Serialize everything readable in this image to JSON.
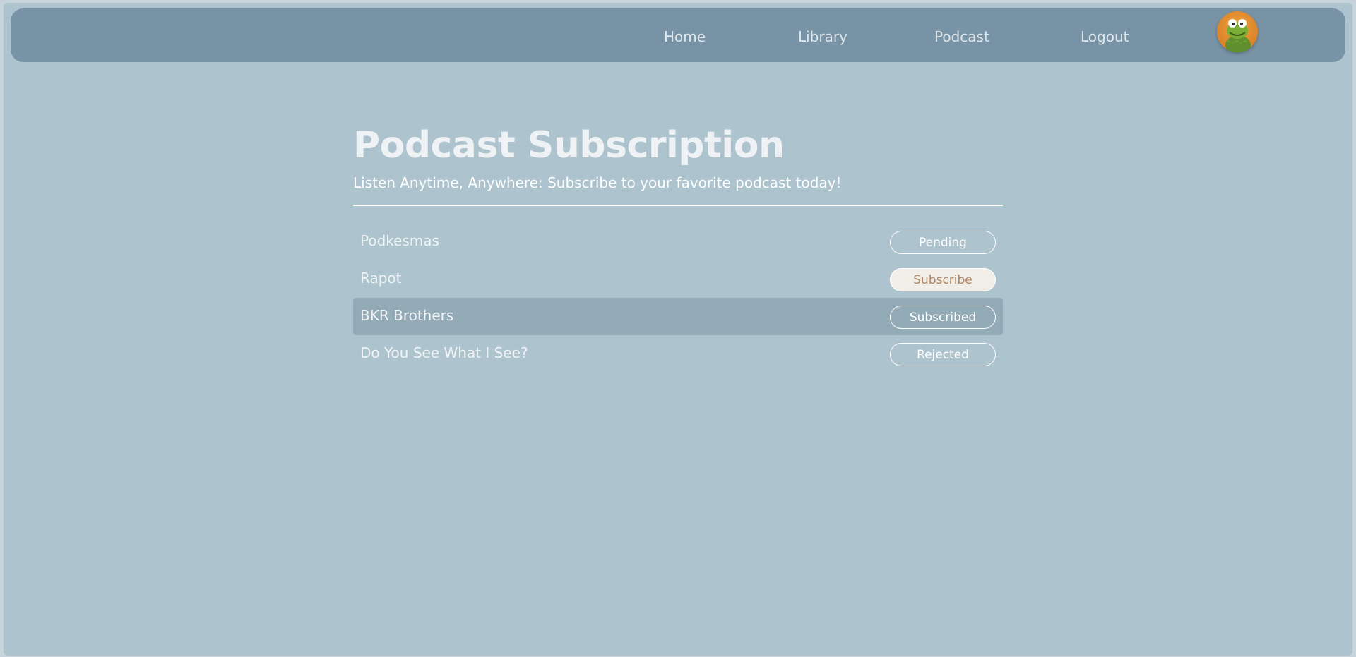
{
  "nav": {
    "items": [
      {
        "label": "Home"
      },
      {
        "label": "Library"
      },
      {
        "label": "Podcast"
      },
      {
        "label": "Logout"
      }
    ],
    "avatar_icon": "frog-avatar-icon"
  },
  "page": {
    "title": "Podcast Subscription",
    "subtitle": "Listen Anytime, Anywhere: Subscribe to your favorite podcast today!"
  },
  "podcasts": [
    {
      "name": "Podkesmas",
      "status": "Pending"
    },
    {
      "name": "Rapot",
      "status": "Subscribe"
    },
    {
      "name": "BKR Brothers",
      "status": "Subscribed"
    },
    {
      "name": "Do You See What I See?",
      "status": "Rejected"
    }
  ],
  "colors": {
    "background": "#adc3cd",
    "navbar": "#7893a6",
    "highlight_row": "#93abb7",
    "subscribe_button_bg": "#f1eee7",
    "subscribe_button_text": "#b08564"
  }
}
